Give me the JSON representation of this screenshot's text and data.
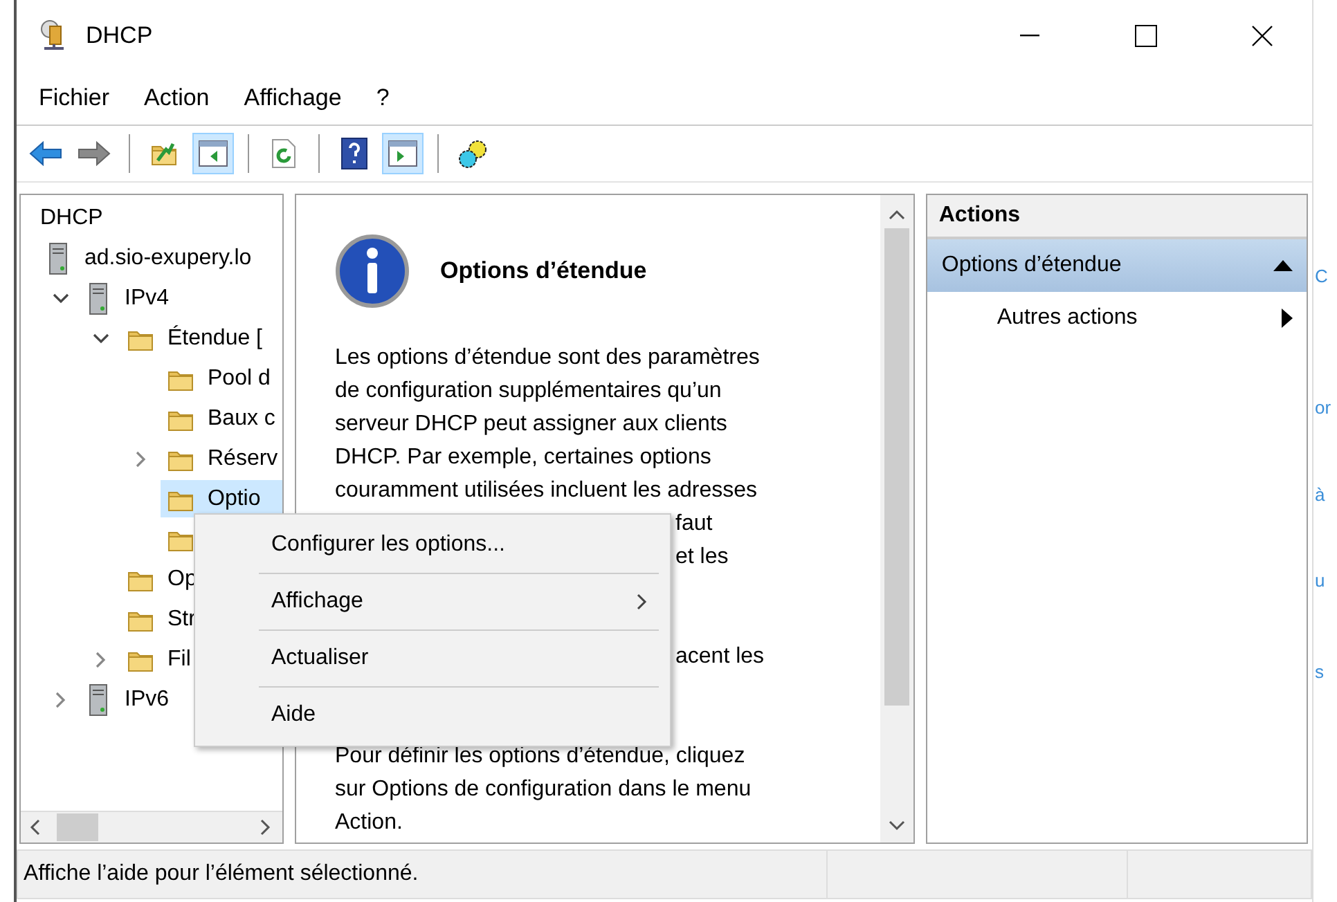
{
  "window": {
    "title": "DHCP"
  },
  "menu_bar": [
    "Fichier",
    "Action",
    "Affichage",
    "?"
  ],
  "toolbar": [
    {
      "kind": "back",
      "pressed": false
    },
    {
      "kind": "forward",
      "pressed": false
    },
    {
      "kind": "separator"
    },
    {
      "kind": "up",
      "pressed": false
    },
    {
      "kind": "console-tree",
      "pressed": true
    },
    {
      "kind": "separator"
    },
    {
      "kind": "refresh",
      "pressed": false
    },
    {
      "kind": "separator"
    },
    {
      "kind": "help",
      "pressed": false
    },
    {
      "kind": "action-pane",
      "pressed": true
    },
    {
      "kind": "separator"
    },
    {
      "kind": "gears",
      "pressed": false
    }
  ],
  "tree": {
    "label": "DHCP",
    "selected": false,
    "children": [
      {
        "label": "ad.sio-exupery.lo",
        "kind": "server",
        "selected": false,
        "children": [
          {
            "label": "IPv4",
            "kind": "server",
            "expanded": true,
            "selected": false,
            "children": [
              {
                "label": "Étendue [",
                "kind": "folder",
                "expanded": true,
                "selected": false,
                "children": [
                  {
                    "label": "Pool d",
                    "kind": "folder",
                    "selected": false
                  },
                  {
                    "label": "Baux c",
                    "kind": "folder",
                    "selected": false
                  },
                  {
                    "label": "Réserv",
                    "kind": "folder",
                    "expanded": false,
                    "selected": false
                  },
                  {
                    "label": "Optio",
                    "kind": "folder",
                    "selected": true
                  },
                  {
                    "kind": "folder",
                    "selected": false
                  }
                ]
              },
              {
                "label": "Op",
                "kind": "folder",
                "selected": false
              },
              {
                "label": "Str",
                "kind": "folder",
                "selected": false
              },
              {
                "label": "Fil",
                "kind": "folder",
                "expanded": false,
                "selected": false
              }
            ]
          },
          {
            "label": "IPv6",
            "kind": "server",
            "expanded": false,
            "selected": false
          }
        ]
      }
    ]
  },
  "details": {
    "title": "Options d’étendue",
    "paragraph_lines": [
      "Les options d’étendue sont des paramètres",
      "de configuration supplémentaires qu’un",
      "serveur DHCP peut assigner aux clients",
      "DHCP. Par exemple, certaines options",
      "couramment utilisées incluent les adresses"
    ],
    "visible_fragments": [
      "faut",
      "et les",
      "acent les"
    ],
    "last_paragraph_lines": [
      "Pour définir les options d’étendue, cliquez",
      "sur Options de configuration dans le menu",
      "Action."
    ]
  },
  "actions": {
    "header": "Actions",
    "section": {
      "title": "Options d’étendue",
      "expanded": true
    },
    "items": [
      {
        "label": "Autres actions",
        "submenu": true
      }
    ]
  },
  "context_menu": [
    {
      "label": "Configurer les options...",
      "submenu": false
    },
    {
      "label": "Affichage",
      "submenu": true
    },
    {
      "label": "Actualiser",
      "submenu": false
    },
    {
      "label": "Aide",
      "submenu": false
    }
  ],
  "status_bar": "Affiche l’aide pour l’élément sélectionné.",
  "background_fragments": [
    "C",
    "or",
    "à",
    "u",
    "s"
  ]
}
